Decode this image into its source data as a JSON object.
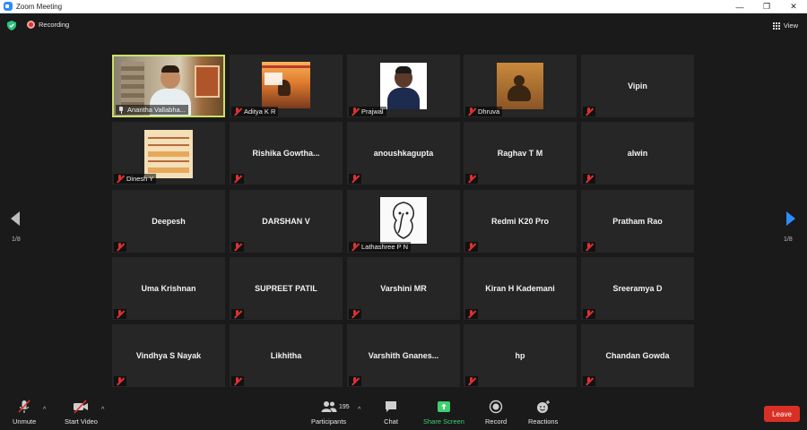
{
  "window": {
    "title": "Zoom Meeting"
  },
  "topbar": {
    "recording_label": "Recording",
    "view_label": "View"
  },
  "navigation": {
    "left_page": "1/8",
    "right_page": "1/8"
  },
  "participants": [
    {
      "name": "Anantha Vallabha...",
      "display": "video",
      "active": true,
      "pinned": true
    },
    {
      "name": "Aditya K R",
      "display": "image"
    },
    {
      "name": "Prajwal",
      "display": "image"
    },
    {
      "name": "Dhruva",
      "display": "image"
    },
    {
      "name": "Vipin",
      "display": "name"
    },
    {
      "name": "Dinesh Y",
      "display": "image"
    },
    {
      "name": "Rishika  Gowtha...",
      "display": "name"
    },
    {
      "name": "anoushkagupta",
      "display": "name"
    },
    {
      "name": "Raghav T M",
      "display": "name"
    },
    {
      "name": "alwin",
      "display": "name"
    },
    {
      "name": "Deepesh",
      "display": "name"
    },
    {
      "name": "DARSHAN V",
      "display": "name"
    },
    {
      "name": "Lathashree P N",
      "display": "image"
    },
    {
      "name": "Redmi K20 Pro",
      "display": "name"
    },
    {
      "name": "Pratham Rao",
      "display": "name"
    },
    {
      "name": "Uma Krishnan",
      "display": "name"
    },
    {
      "name": "SUPREET  PATIL",
      "display": "name"
    },
    {
      "name": "Varshini MR",
      "display": "name"
    },
    {
      "name": "Kiran H Kademani",
      "display": "name"
    },
    {
      "name": "Sreeramya D",
      "display": "name"
    },
    {
      "name": "Vindhya S Nayak",
      "display": "name"
    },
    {
      "name": "Likhitha",
      "display": "name"
    },
    {
      "name": "Varshith  Gnanes...",
      "display": "name"
    },
    {
      "name": "hp",
      "display": "name"
    },
    {
      "name": "Chandan Gowda",
      "display": "name"
    }
  ],
  "toolbar": {
    "unmute": "Unmute",
    "start_video": "Start Video",
    "participants": "Participants",
    "participant_count": "195",
    "chat": "Chat",
    "share_screen": "Share Screen",
    "record": "Record",
    "reactions": "Reactions",
    "leave": "Leave"
  },
  "colors": {
    "active_border": "#c8e06a",
    "share_green": "#3bd16f",
    "leave_red": "#d93025",
    "accent_blue": "#2d8cff"
  }
}
